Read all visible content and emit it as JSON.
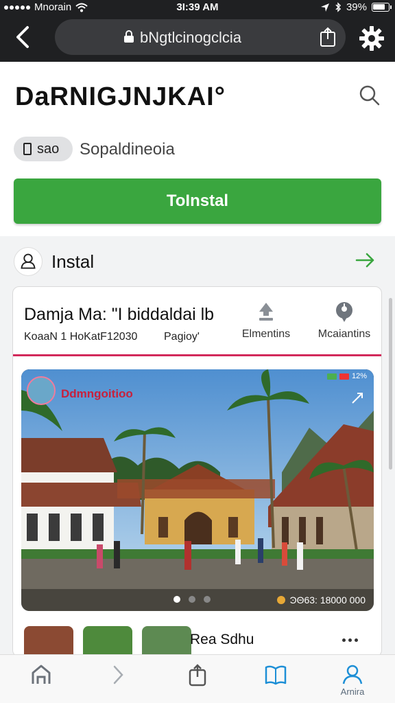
{
  "status_bar": {
    "carrier": "Mnorain",
    "time": "3I:39 AM",
    "battery": "39%"
  },
  "browser": {
    "url": "bNgtlcinogclcia"
  },
  "header": {
    "title": "DaRNIGJNJKAI°",
    "chip_label": "sao",
    "subtitle": "Sopaldineoia",
    "install_button": "ToInstal"
  },
  "section": {
    "title": "Instal"
  },
  "card": {
    "title": "Damja Ma: \"I biddaldai lb",
    "meta_left": "KoaaN 1 HoKatF12030",
    "meta_mid": "Pagioy'",
    "actions": [
      {
        "label": "Elmentins",
        "icon": "upload-arrow-icon"
      },
      {
        "label": "Mcaiantins",
        "icon": "pin-icon"
      }
    ],
    "photo": {
      "label": "Ddmngoitioo",
      "status": "12%",
      "counter": "ϿΘ63: 18000 000",
      "page_current": 1,
      "page_total": 3
    },
    "thumb_title": "Rea Sdhu"
  },
  "bottom_nav": {
    "items": [
      {
        "label": "",
        "icon": "home-icon"
      },
      {
        "label": "",
        "icon": "chevron-right-icon"
      },
      {
        "label": "",
        "icon": "share-icon"
      },
      {
        "label": "",
        "icon": "book-icon"
      },
      {
        "label": "Arnira",
        "icon": "person-icon"
      }
    ]
  },
  "colors": {
    "accent_green": "#3aa63f",
    "divider_pink": "#d2295a",
    "nav_blue": "#1d8fd6"
  }
}
